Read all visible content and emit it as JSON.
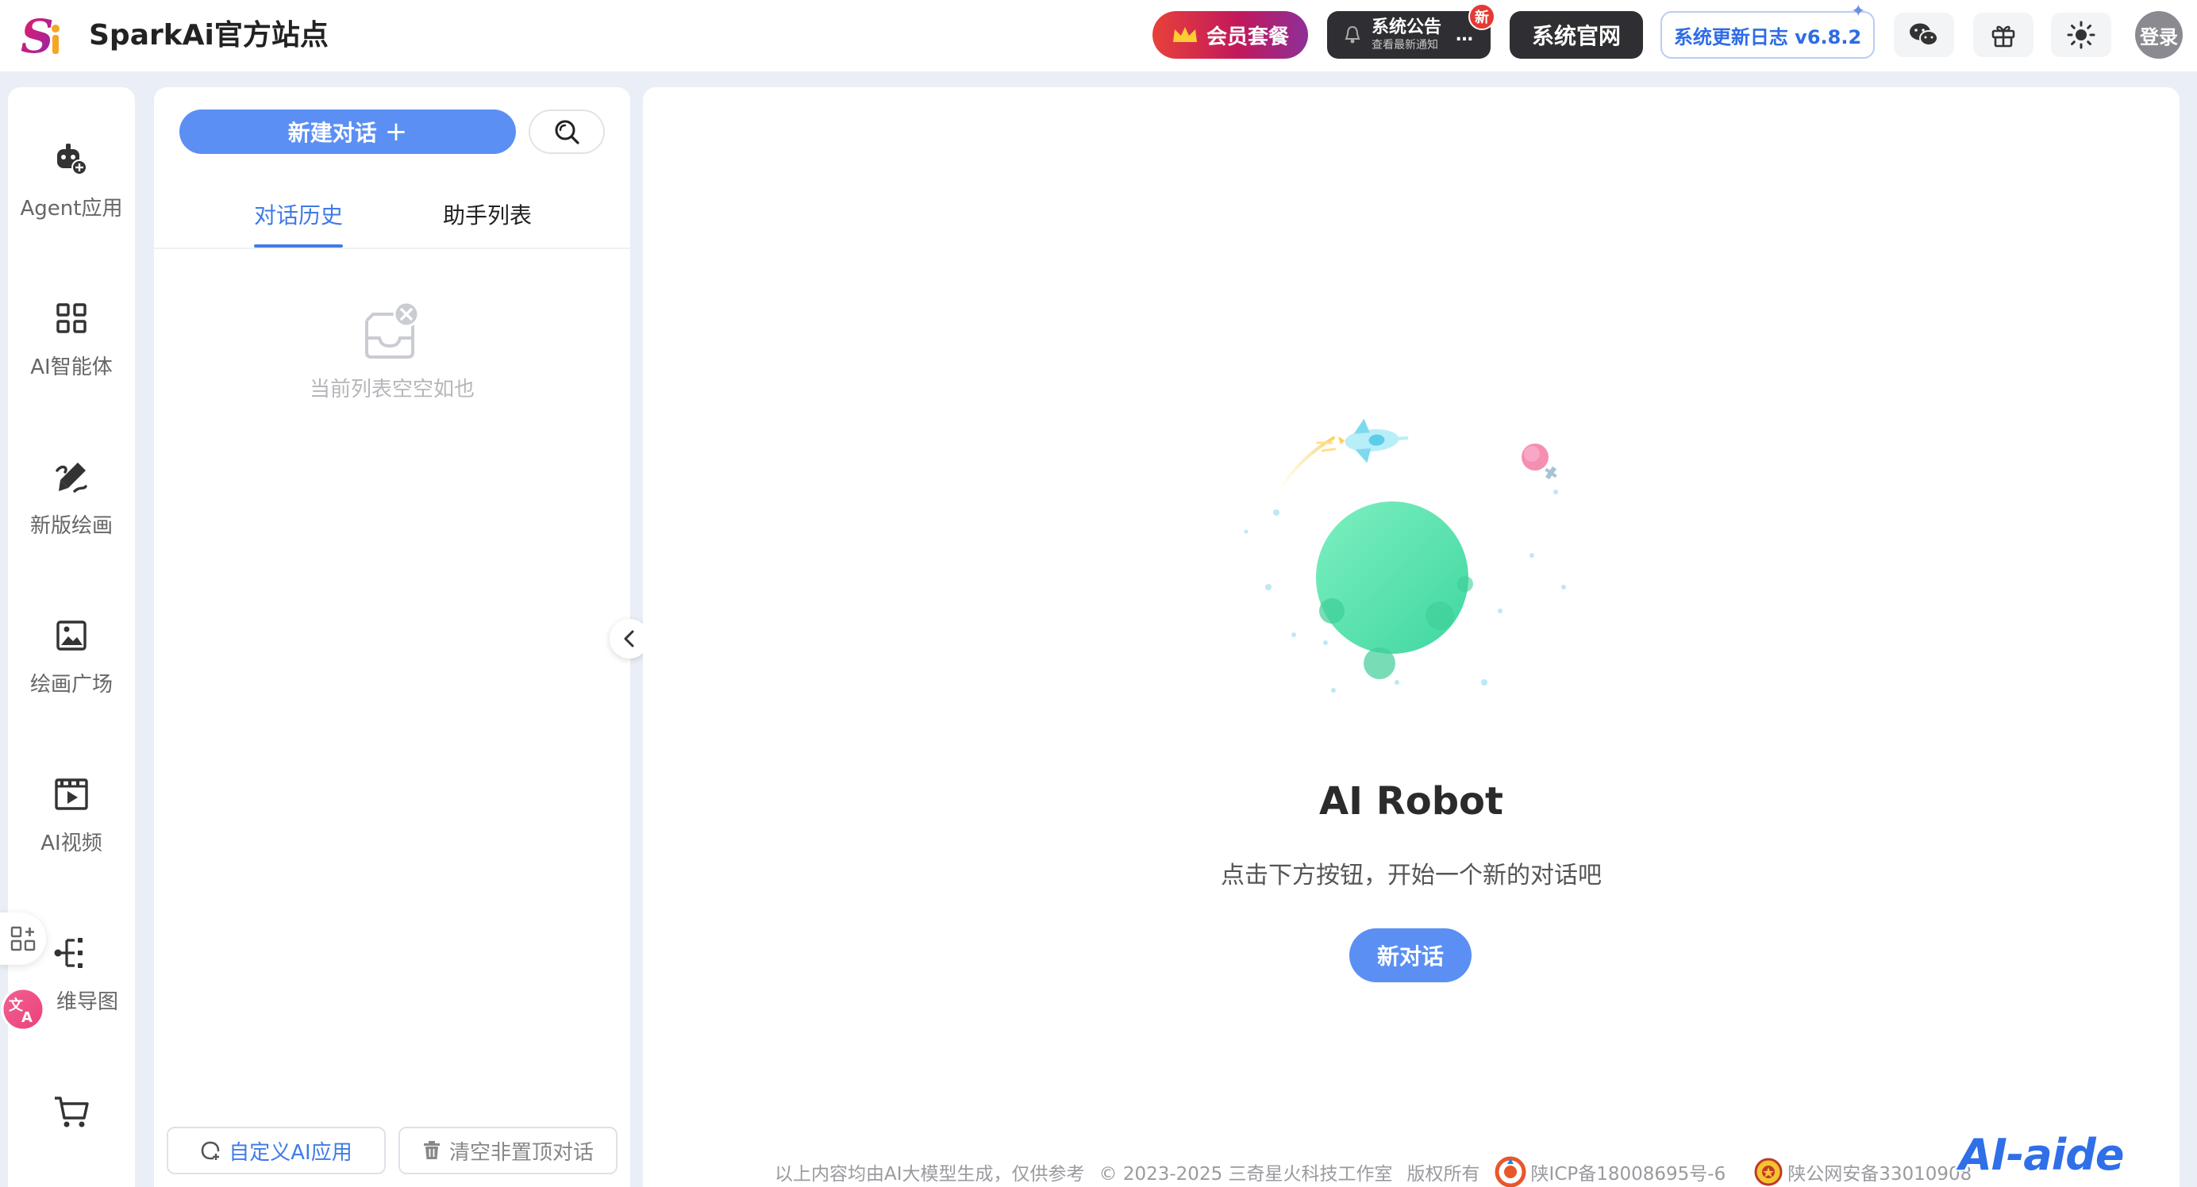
{
  "header": {
    "brand_name": "SparkAi官方站点",
    "logo_text": "S",
    "member_label": "会员套餐",
    "announce_title": "系统公告",
    "announce_sub": "查看最新通知",
    "announce_more": "…",
    "badge_new": "新",
    "site_label": "系统官网",
    "changelog_label": "系统更新日志 v6.8.2",
    "login_label": "登录"
  },
  "sidebar": {
    "items": [
      {
        "label": "Agent应用",
        "icon": "agent-robot-icon"
      },
      {
        "label": "AI智能体",
        "icon": "grid-apps-icon"
      },
      {
        "label": "新版绘画",
        "icon": "paint-brush-icon"
      },
      {
        "label": "绘画广场",
        "icon": "image-gallery-icon"
      },
      {
        "label": "AI视频",
        "icon": "video-play-icon"
      },
      {
        "label": "维导图",
        "icon": "mindmap-icon"
      },
      {
        "label": "",
        "icon": "shopping-cart-icon"
      }
    ]
  },
  "history": {
    "new_chat_label": "新建对话",
    "new_chat_plus": "+",
    "tabs": [
      {
        "label": "对话历史",
        "active": true
      },
      {
        "label": "助手列表",
        "active": false
      }
    ],
    "empty_text": "当前列表空空如也",
    "custom_app_label": "自定义AI应用",
    "clear_label": "清空非置顶对话"
  },
  "main": {
    "title": "AI Robot",
    "subtitle": "点击下方按钮，开始一个新的对话吧",
    "new_chat_label": "新对话"
  },
  "footer": {
    "disclaimer": "以上内容均由AI大模型生成，仅供参考",
    "copyright": "© 2023-2025 三奇星火科技工作室",
    "rights": "版权所有",
    "icp": "陕ICP备18008695号-6",
    "police": "陕公网安备33010908"
  },
  "watermark": "AI-aide",
  "colors": {
    "accent": "#5b8ff4",
    "tab_active": "#3f7be6",
    "dark_button": "#2f2f33",
    "planet": "#5ee6b0"
  }
}
